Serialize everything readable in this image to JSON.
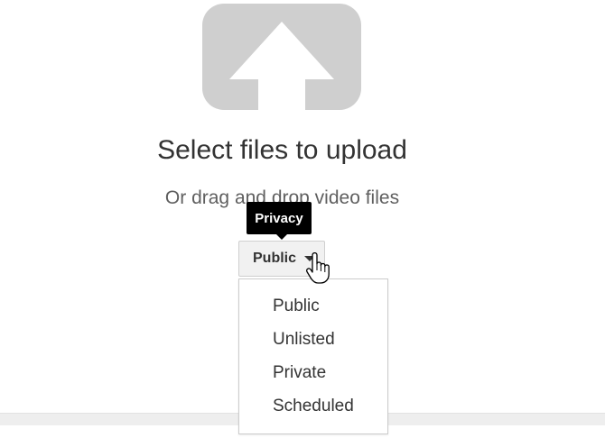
{
  "upload": {
    "icon": "upload-arrow-icon",
    "title": "Select files to upload",
    "subtitle": "Or drag and drop video files"
  },
  "privacy": {
    "tooltip": "Privacy",
    "selected": "Public",
    "options": [
      "Public",
      "Unlisted",
      "Private",
      "Scheduled"
    ]
  },
  "colors": {
    "icon_gray": "#cfcfcf",
    "button_bg": "#f1f1f1",
    "tooltip_bg": "#000000"
  }
}
